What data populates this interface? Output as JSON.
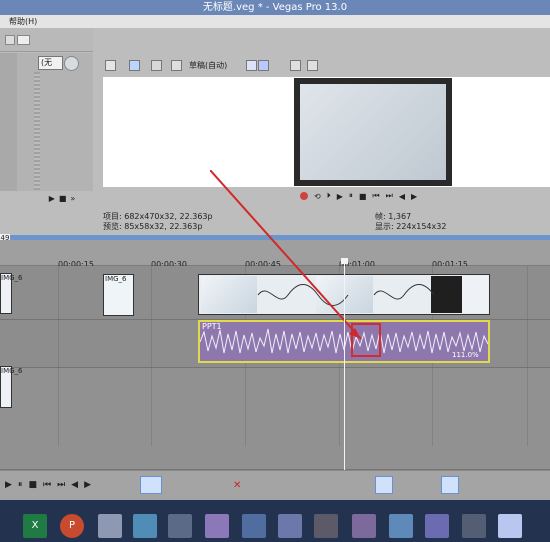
{
  "app": {
    "title": "无标题.veg * - Vegas Pro 13.0"
  },
  "menu": {
    "items": [
      "帮助(H)"
    ]
  },
  "left_panel": {
    "combo": "(无"
  },
  "preview_toolbar": {
    "quality": "草稿(自动)"
  },
  "preview_info": {
    "project_label": "项目: 682x470x32, 22.363p",
    "preview_label": "预览: 85x58x32, 22.363p",
    "frame_label": "帧:",
    "frame_value": "1,367",
    "display_label": "显示:",
    "display_value": "224x154x32"
  },
  "timeline": {
    "cursor_box": "49",
    "ticks": [
      "00:00:15",
      "00:00:30",
      "00:00:45",
      "00:01:00",
      "00:01:15"
    ],
    "top_clip_1_label": "IMG_6",
    "top_clip_2_label": "IMG_6",
    "top_clip_3_label": "IMG_6",
    "audio_clip_label": "PPT1",
    "audio_clip_value": "111.0%"
  },
  "bottom_toolbar": {
    "items": [
      "play",
      "pause",
      "stop",
      "prev",
      "next",
      "split",
      "trim"
    ]
  },
  "taskbar": {
    "apps": [
      "Excel",
      "PowerPoint"
    ]
  },
  "colors": {
    "title_bg": "#6b87b8",
    "timeline_blue": "#6d95cc",
    "audio_fill": "#8e77ad",
    "audio_border": "#e1da49",
    "arrow_red": "#d2282a",
    "taskbar_bg": "#23324f"
  }
}
